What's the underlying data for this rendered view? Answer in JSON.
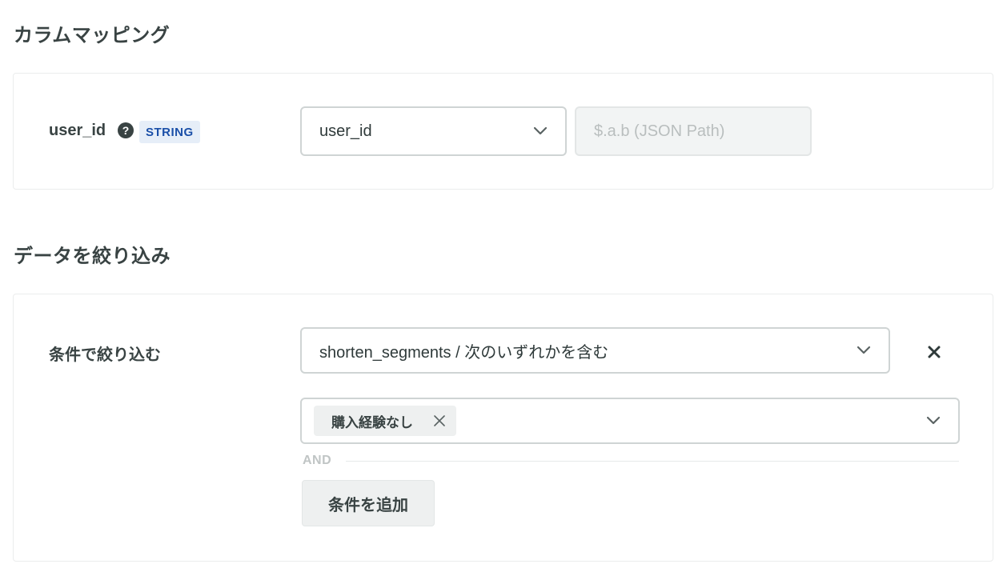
{
  "mapping_section": {
    "title": "カラムマッピング",
    "field_label": "user_id",
    "help_icon": "question-circle-icon",
    "type_badge": "STRING",
    "column_select_value": "user_id",
    "json_path_placeholder": "$.a.b (JSON Path)"
  },
  "filter_section": {
    "title": "データを絞り込み",
    "field_label": "条件で絞り込む",
    "condition_select_value": "shorten_segments / 次のいずれかを含む",
    "selected_tags": [
      "購入経験なし"
    ],
    "and_label": "AND",
    "add_condition_label": "条件を追加"
  },
  "icons": {
    "chevron": "chevron-down-icon",
    "remove": "close-icon"
  },
  "colors": {
    "text": "#394343",
    "badge_bg": "#e6eef8",
    "badge_text": "#1a4fa8",
    "border": "#cfd4d4"
  }
}
